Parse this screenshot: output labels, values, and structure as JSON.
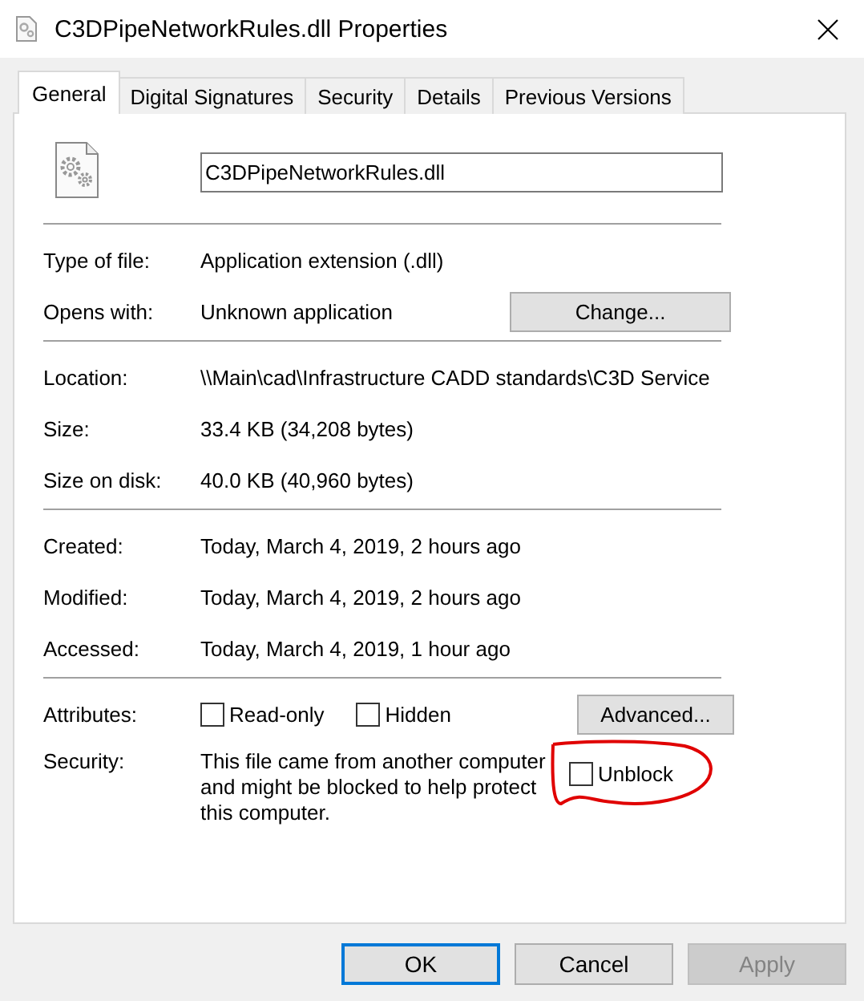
{
  "window": {
    "title": "C3DPipeNetworkRules.dll Properties"
  },
  "tabs": [
    {
      "label": "General",
      "selected": true
    },
    {
      "label": "Digital Signatures",
      "selected": false
    },
    {
      "label": "Security",
      "selected": false
    },
    {
      "label": "Details",
      "selected": false
    },
    {
      "label": "Previous Versions",
      "selected": false
    }
  ],
  "file_name": {
    "value": "C3DPipeNetworkRules.dll"
  },
  "sections": [
    [
      {
        "kind": "text",
        "label": "Type of file:",
        "value": "Application extension (.dll)"
      },
      {
        "kind": "text",
        "label": "Opens with:",
        "value": "Unknown application",
        "button": "Change..."
      }
    ],
    [
      {
        "kind": "text",
        "label": "Location:",
        "value": "\\\\Main\\cad\\Infrastructure CADD standards\\C3D Service"
      },
      {
        "kind": "text",
        "label": "Size:",
        "value": "33.4 KB (34,208 bytes)"
      },
      {
        "kind": "text",
        "label": "Size on disk:",
        "value": "40.0 KB (40,960 bytes)"
      }
    ],
    [
      {
        "kind": "text",
        "label": "Created:",
        "value": "Today, March 4, 2019, 2 hours ago"
      },
      {
        "kind": "text",
        "label": "Modified:",
        "value": "Today, March 4, 2019, 2 hours ago"
      },
      {
        "kind": "text",
        "label": "Accessed:",
        "value": "Today, March 4, 2019, 1 hour ago"
      }
    ],
    [
      {
        "kind": "checkboxes",
        "label": "Attributes:",
        "checkboxes": [
          {
            "label": "Read-only",
            "checked": false
          },
          {
            "label": "Hidden",
            "checked": false
          }
        ],
        "button": "Advanced..."
      },
      {
        "kind": "security",
        "label": "Security:",
        "value": "This file came from another computer and might be blocked to help protect this computer.",
        "checkbox": {
          "label": "Unblock",
          "checked": false
        }
      }
    ]
  ],
  "buttons": [
    {
      "label": "OK",
      "default": true,
      "disabled": false
    },
    {
      "label": "Cancel",
      "default": false,
      "disabled": false
    },
    {
      "label": "Apply",
      "default": false,
      "disabled": true
    }
  ]
}
